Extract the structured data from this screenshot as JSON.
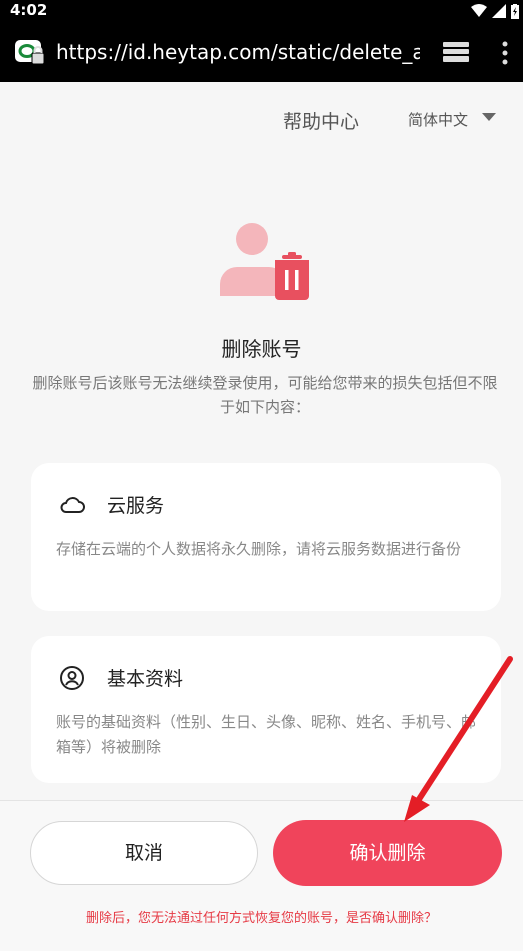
{
  "status_bar": {
    "time": "4:02"
  },
  "browser": {
    "url": "https://id.heytap.com/static/delete_acco"
  },
  "header": {
    "help_center": "帮助中心",
    "language": "简体中文"
  },
  "page": {
    "title": "删除账号",
    "description": "删除账号后该账号无法继续登录使用，可能给您带来的损失包括但不限于如下内容："
  },
  "cards": [
    {
      "icon": "cloud-icon",
      "title": "云服务",
      "body": "存储在云端的个人数据将永久删除，请将云服务数据进行备份"
    },
    {
      "icon": "user-circle-icon",
      "title": "基本资料",
      "body": "账号的基础资料（性别、生日、头像、昵称、姓名、手机号、邮箱等）将被删除"
    }
  ],
  "actions": {
    "cancel": "取消",
    "confirm": "确认删除"
  },
  "warning": "删除后，您无法通过任何方式恢复您的账号，是否确认删除？",
  "colors": {
    "accent": "#f0445b",
    "icon_pink": "#f4b6bb",
    "trash_red": "#e8505f",
    "annotation_arrow": "#e41e26"
  }
}
